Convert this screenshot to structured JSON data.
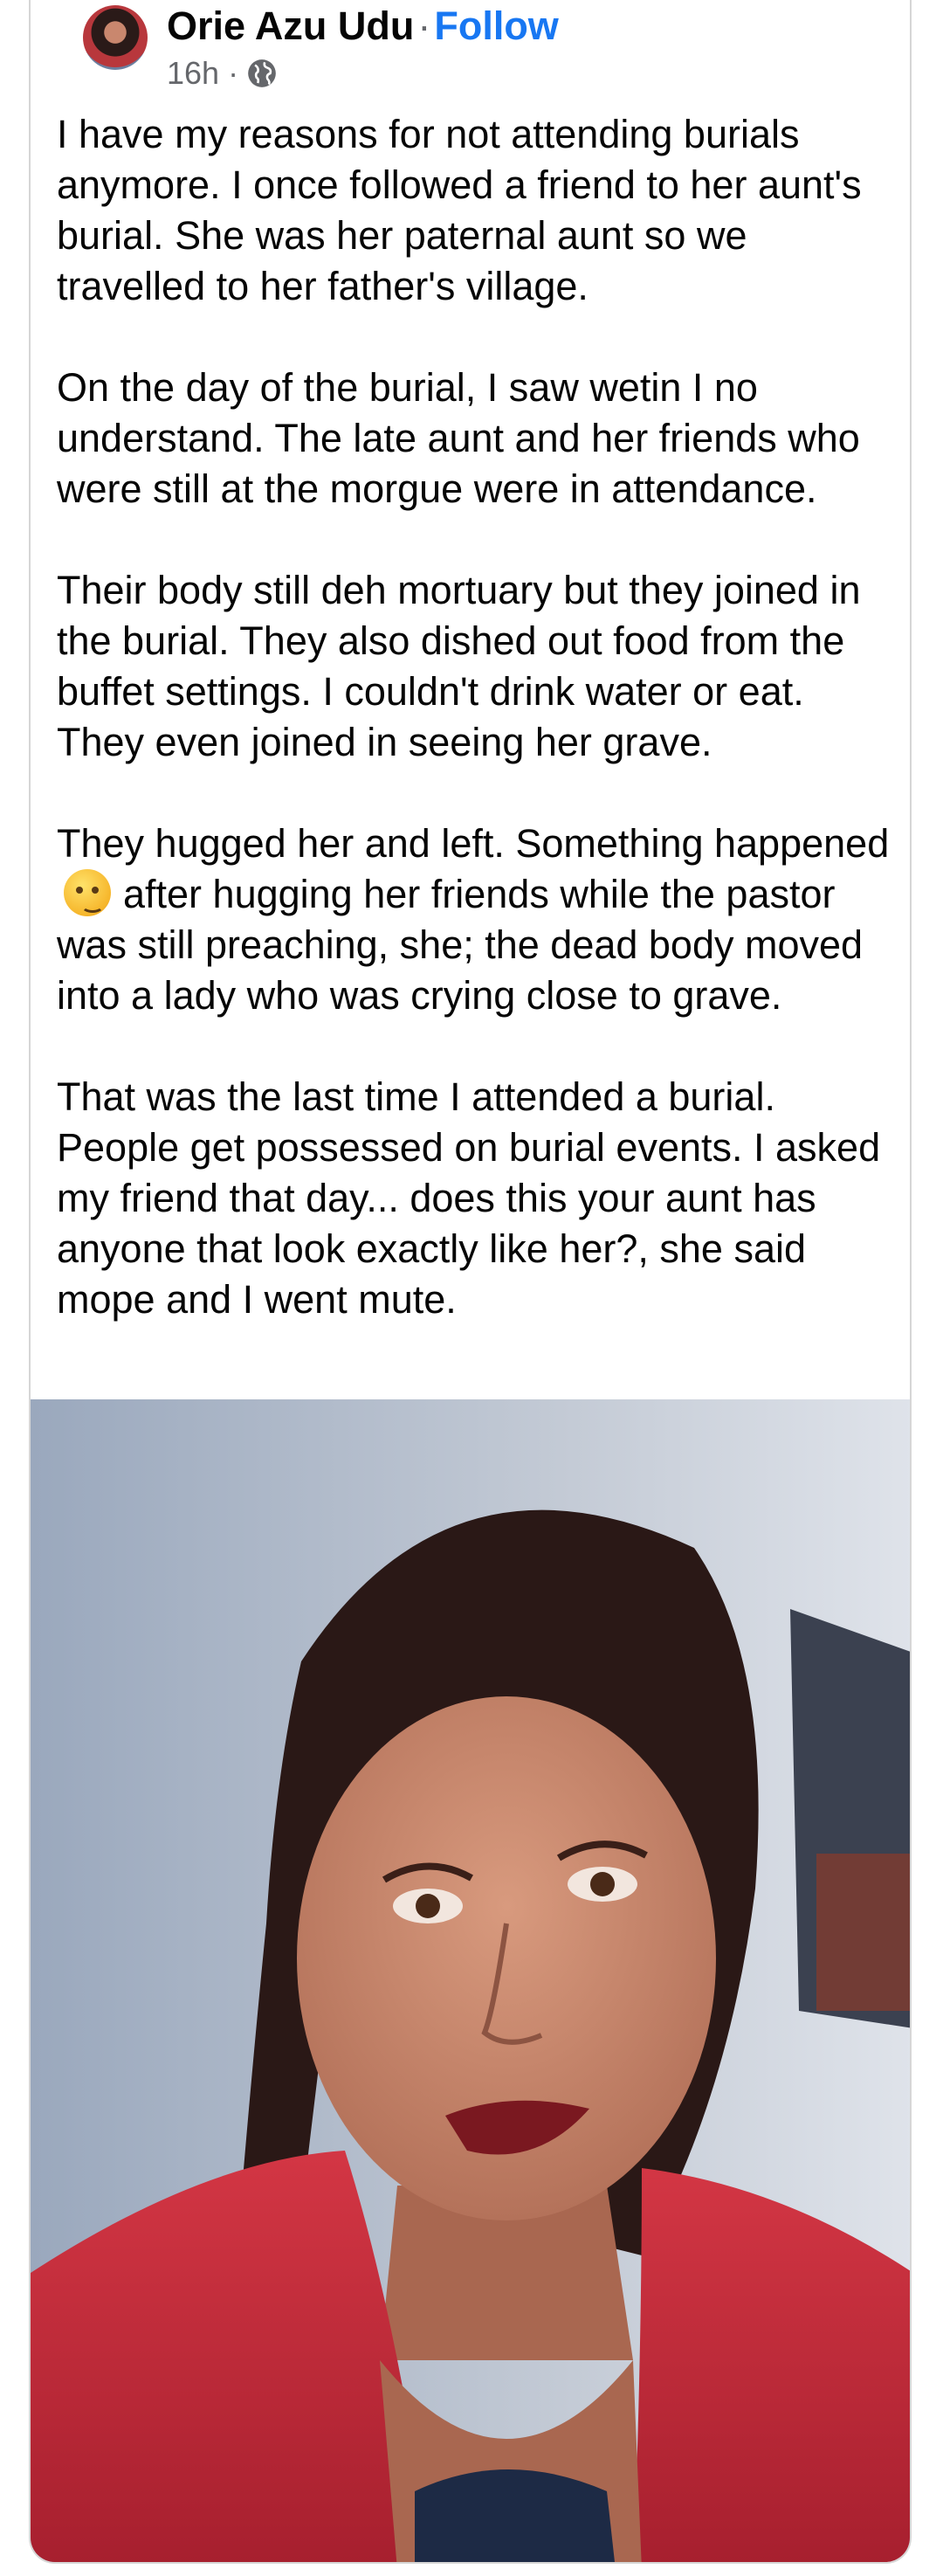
{
  "post": {
    "author": "Orie Azu Udu",
    "separator": "·",
    "follow_label": "Follow",
    "time": "16h ·",
    "audience_icon": "globe-icon",
    "paragraphs": [
      "I have my reasons for not attending burials anymore. I once followed a friend to her aunt's burial. She was her paternal aunt so we travelled to her father's village.",
      "On the day of the burial, I saw wetin I no understand. The late aunt and her friends who were still at the morgue were in attendance.",
      "Their body still deh mortuary but they joined in the burial. They also dished out food from the buffet settings. I couldn't drink water or eat. They even joined in seeing her grave.",
      "They hugged her and left. Something happened",
      "after hugging her friends while the pastor was still preaching, she; the dead body moved into a lady who was crying close to grave.",
      "That was the last time I attended a burial. People get possessed on burial events. I asked my friend that day... does this your aunt has anyone that look exactly like her?, she said mope and I went mute."
    ],
    "emoji": "thinking-face-emoji",
    "photo": "selfie-woman-red-top"
  },
  "colors": {
    "link": "#1877f2",
    "meta": "#65676b",
    "text": "#050505",
    "border": "#d6d6d6"
  }
}
